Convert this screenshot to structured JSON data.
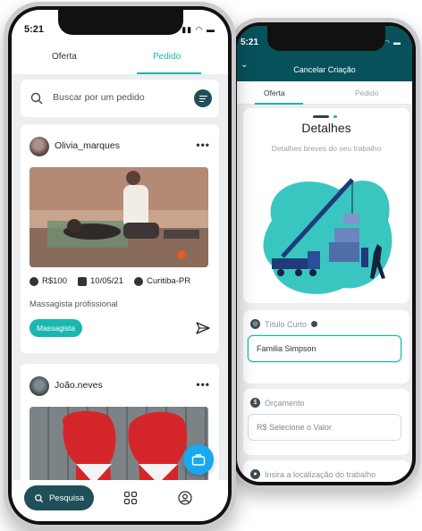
{
  "back_phone": {
    "status_time": "5:21",
    "header_title": "Cancelar Criação",
    "tabs": [
      {
        "label": "Oferta"
      },
      {
        "label": "Pedido"
      }
    ],
    "details_title": "Detalhes",
    "details_subtitle": "Detalhes breves do seu trabalho",
    "illustration": "crane-construction-illustration",
    "fields": [
      {
        "label": "Título Curto",
        "icon": "target-icon",
        "value": "Familia Simpson"
      },
      {
        "label": "Orçamento",
        "icon": "dollar-icon",
        "value": "R$ Selecione o Valor"
      },
      {
        "label": "Insira a localização do trabalho",
        "icon": "location-pin-icon"
      }
    ]
  },
  "front_phone": {
    "status_time": "5:21",
    "tabs": [
      {
        "label": "Oferta"
      },
      {
        "label": "Pedido"
      }
    ],
    "active_tab": "Pedido",
    "search": {
      "placeholder": "Buscar por um pedido"
    },
    "posts": [
      {
        "username": "Olivia_marques",
        "image": "massage-photo",
        "price": "R$100",
        "date": "10/05/21",
        "location": "Curitiba-PR",
        "description": "Massagista profissional",
        "tag": "Massagista"
      },
      {
        "username": "João.neves",
        "image": "boxing-gloves-photo"
      }
    ],
    "bottom_nav": {
      "search_label": "Pesquisa"
    }
  },
  "colors": {
    "accent": "#1ab7b1",
    "dark_teal": "#07515b",
    "fab_blue": "#1aa8f0",
    "nav_pill": "#1f4f58"
  }
}
